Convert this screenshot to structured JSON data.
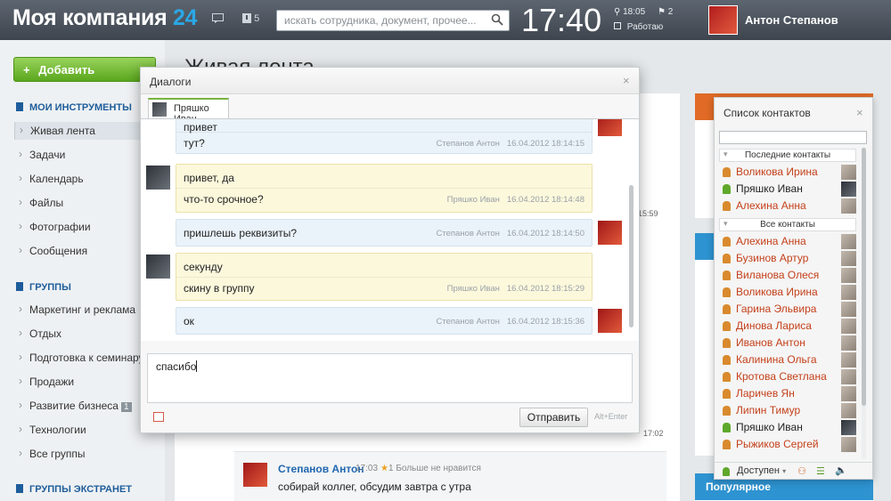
{
  "header": {
    "logo_text": "Моя компания",
    "logo_num": "24",
    "messages_count": "5",
    "search_placeholder": "искать сотрудника, документ, прочее...",
    "clock": "17:40",
    "work_time": "18:05",
    "tasks_count": "2",
    "work_status": "Работаю",
    "user_name": "Антон Степанов"
  },
  "sidebar": {
    "add_label": "Добавить",
    "my_tools_title": "МОИ ИНСТРУМЕНТЫ",
    "tools": [
      "Живая лента",
      "Задачи",
      "Календарь",
      "Файлы",
      "Фотографии",
      "Сообщения"
    ],
    "groups_title": "ГРУППЫ",
    "groups": [
      "Маркетинг и реклама",
      "Отдых",
      "Подготовка к семинару.",
      "Продажи",
      "Развитие бизнеса",
      "Технологии",
      "Все группы"
    ],
    "groups_badge": "1",
    "extranet_title": "ГРУППЫ ЭКСТРАНЕТ"
  },
  "background": {
    "page_title": "Живая лента",
    "comment_author": "Степанов Антон",
    "comment_time": "17:03",
    "comment_likes": "1",
    "comment_like_text": "Больше не нравится",
    "comment_text": "собирай коллег, обсудим завтра с утра",
    "time_1": "15:59",
    "time_2": "17:02",
    "popular": "Популярное"
  },
  "dialog": {
    "title": "Диалоги",
    "tab_name": "Пряшко Иван",
    "messages": [
      {
        "lines": [
          "привет",
          "тут?"
        ],
        "author": "Степанов Антон",
        "date": "16.04.2012 18:14:15",
        "style": "blue"
      },
      {
        "lines": [
          "привет, да",
          "что-то срочное?"
        ],
        "author": "Пряшко Иван",
        "date": "16.04.2012 18:14:48",
        "style": "yellow"
      },
      {
        "lines": [
          "пришлешь реквизиты?"
        ],
        "author": "Степанов Антон",
        "date": "16.04.2012 18:14:50",
        "style": "blue"
      },
      {
        "lines": [
          "секунду",
          "скину в группу"
        ],
        "author": "Пряшко Иван",
        "date": "16.04.2012 18:15:29",
        "style": "yellow"
      },
      {
        "lines": [
          "ок"
        ],
        "author": "Степанов Антон",
        "date": "16.04.2012 18:15:36",
        "style": "blue"
      }
    ],
    "input_value": "спасибо",
    "send_label": "Отправить",
    "send_hint": "Alt+Enter"
  },
  "contacts": {
    "title": "Список контактов",
    "recent_label": "Последние контакты",
    "all_label": "Все контакты",
    "recent": [
      {
        "name": "Воликова Ирина",
        "status": "offline"
      },
      {
        "name": "Пряшко Иван",
        "status": "online"
      },
      {
        "name": "Алехина Анна",
        "status": "offline"
      }
    ],
    "all": [
      {
        "name": "Алехина Анна",
        "status": "offline"
      },
      {
        "name": "Бузинов Артур",
        "status": "offline"
      },
      {
        "name": "Виланова Олеся",
        "status": "offline"
      },
      {
        "name": "Воликова Ирина",
        "status": "offline"
      },
      {
        "name": "Гарина Эльвира",
        "status": "offline"
      },
      {
        "name": "Динова Лариса",
        "status": "offline"
      },
      {
        "name": "Иванов Антон",
        "status": "offline"
      },
      {
        "name": "Калинина Ольга",
        "status": "offline"
      },
      {
        "name": "Кротова Светлана",
        "status": "offline"
      },
      {
        "name": "Ларичев Ян",
        "status": "offline"
      },
      {
        "name": "Липин Тимур",
        "status": "offline"
      },
      {
        "name": "Пряшко Иван",
        "status": "online"
      },
      {
        "name": "Рыжиков Сергей",
        "status": "offline"
      }
    ],
    "my_status": "Доступен"
  }
}
